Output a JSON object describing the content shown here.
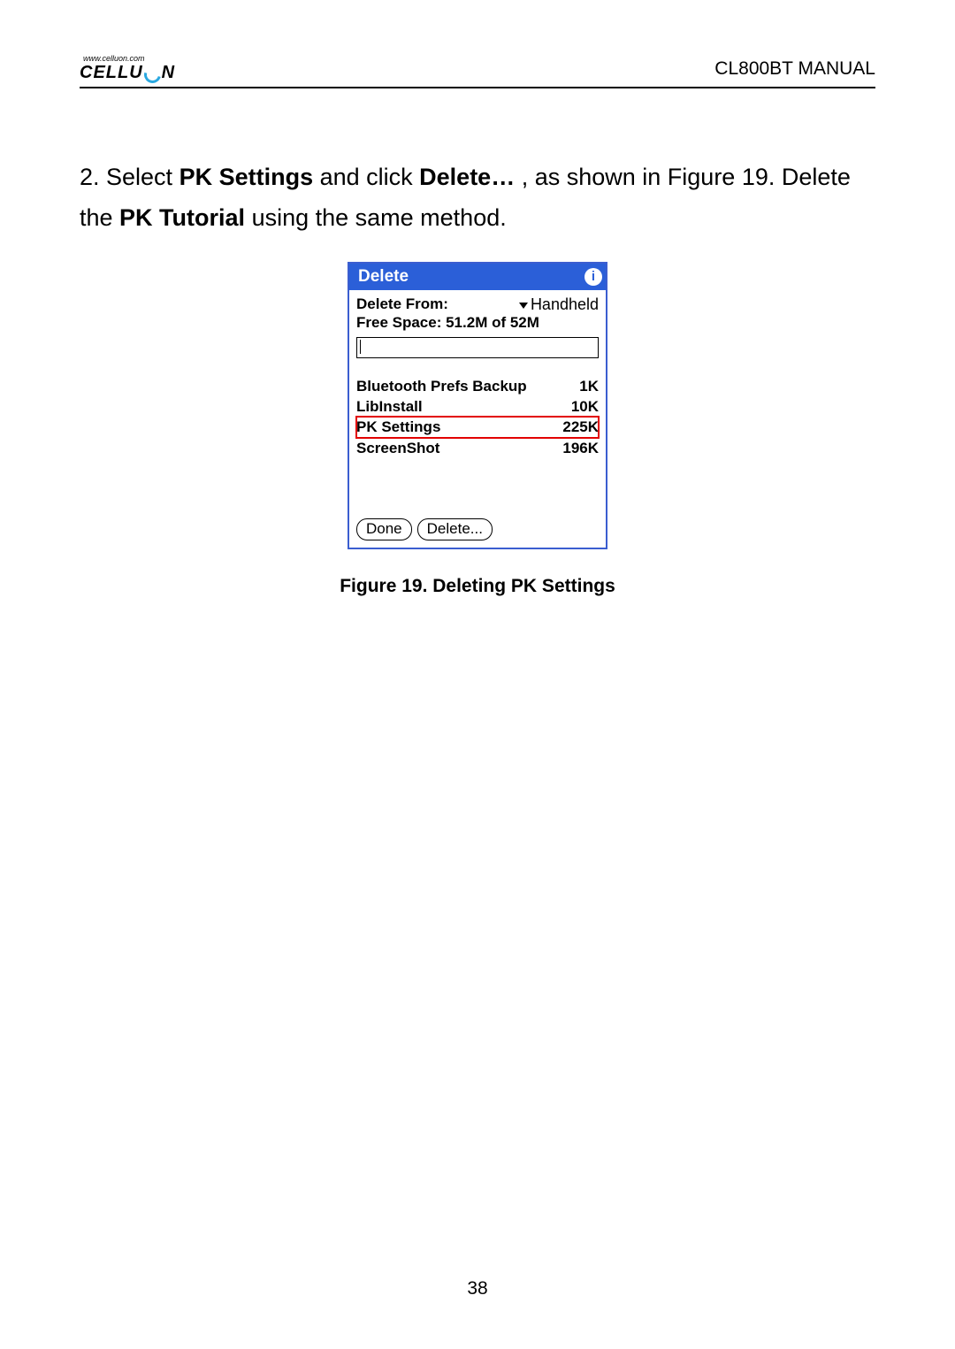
{
  "header": {
    "brand_url": "www.celluon.com",
    "brand_a": "CELLU",
    "brand_b": "N",
    "doc_title": "CL800BT MANUAL"
  },
  "body": {
    "t1": "2. Select ",
    "b1": "PK Settings",
    "t2": " and click ",
    "b2": "Delete…",
    "t3": " , as shown in Figure 19. Delete the ",
    "b3": "PK Tutorial",
    "t4": " using the same method."
  },
  "palm": {
    "title": "Delete",
    "info": "i",
    "delete_from_label": "Delete From:",
    "delete_from_value": "Handheld",
    "free_space": "Free Space: 51.2M of 52M",
    "items": [
      {
        "name": "Bluetooth Prefs Backup",
        "size": "1K",
        "selected": false
      },
      {
        "name": "LibInstall",
        "size": "10K",
        "selected": false
      },
      {
        "name": "PK Settings",
        "size": "225K",
        "selected": true
      },
      {
        "name": "ScreenShot",
        "size": "196K",
        "selected": false
      }
    ],
    "done": "Done",
    "delete": "Delete..."
  },
  "caption": "Figure 19. Deleting PK Settings",
  "page_number": "38"
}
